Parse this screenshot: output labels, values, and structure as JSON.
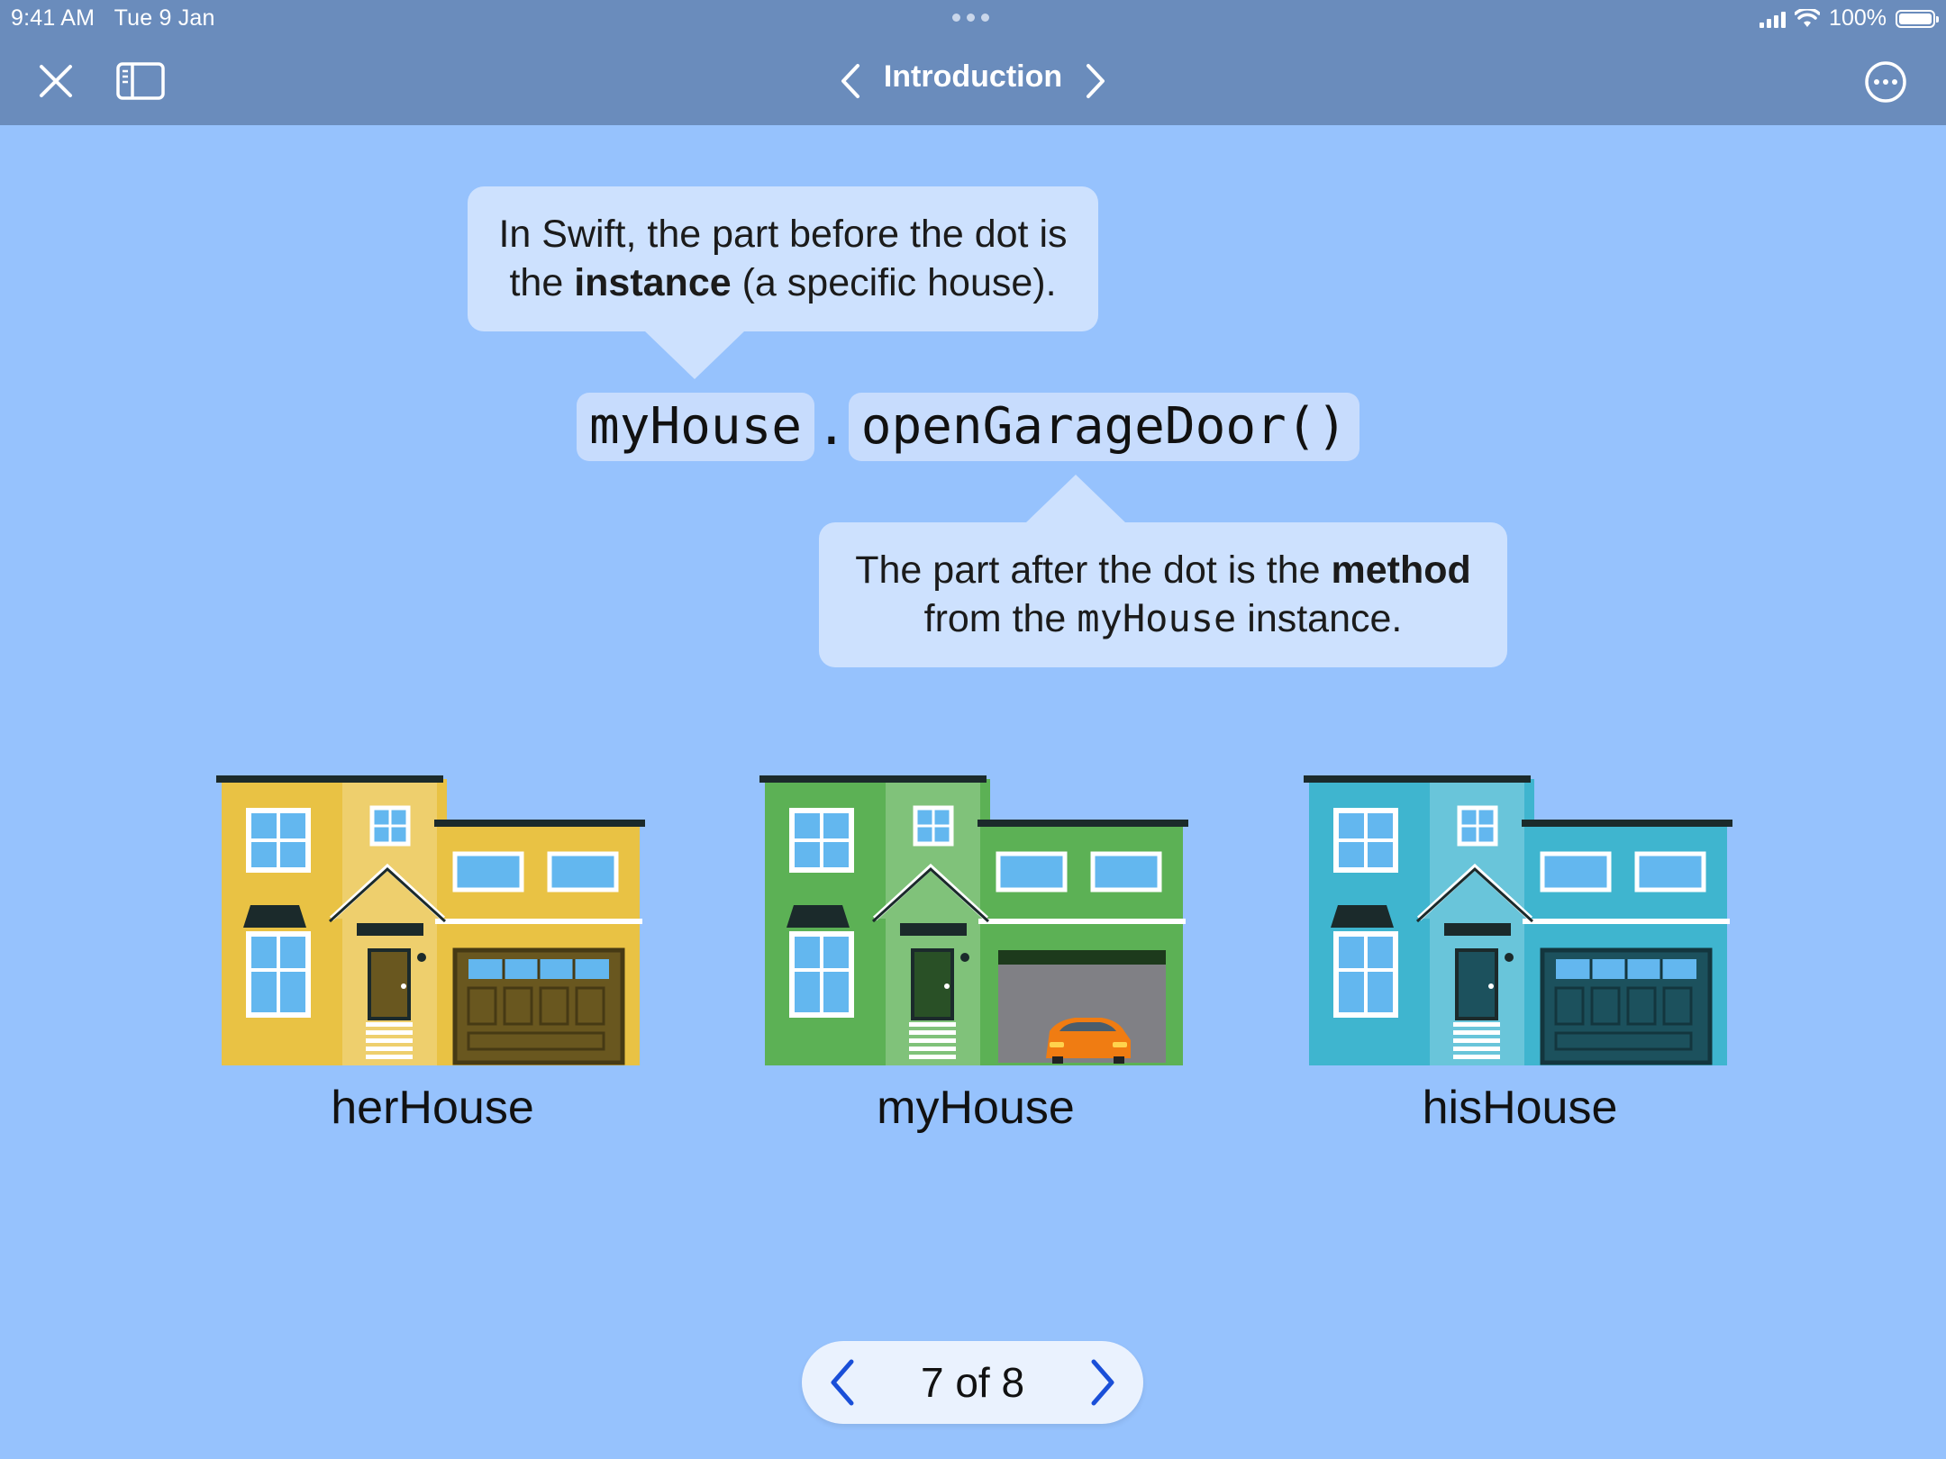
{
  "status_bar": {
    "time": "9:41 AM",
    "date": "Tue 9 Jan",
    "battery": "100%"
  },
  "nav": {
    "title": "Introduction"
  },
  "callout_instance": {
    "line1": "In Swift, the part before the dot is",
    "line2_pre": "the ",
    "line2_bold": "instance",
    "line2_post": " (a specific house)."
  },
  "code": {
    "instance": "myHouse",
    "dot": ".",
    "method": "openGarageDoor()"
  },
  "callout_method": {
    "line1_pre": "The part after the dot is the ",
    "line1_bold": "method",
    "line2_pre": "from the ",
    "line2_code": "myHouse",
    "line2_post": " instance."
  },
  "houses": [
    {
      "label": "herHouse",
      "color": "#e9c244",
      "garage_open": false
    },
    {
      "label": "myHouse",
      "color": "#5cb155",
      "garage_open": true
    },
    {
      "label": "hisHouse",
      "color": "#3fb5cf",
      "garage_open": false
    }
  ],
  "pager": {
    "text": "7 of 8"
  },
  "colors": {
    "background": "#96c2fd",
    "nav_bar": "#6a8cbc",
    "bubble": "#cde1fe",
    "pager_accent": "#1a4fd8"
  },
  "icons": {
    "close": "close-icon",
    "sidebar": "sidebar-icon",
    "prev": "chevron-left-icon",
    "next": "chevron-right-icon",
    "more": "ellipsis-circle-icon"
  }
}
